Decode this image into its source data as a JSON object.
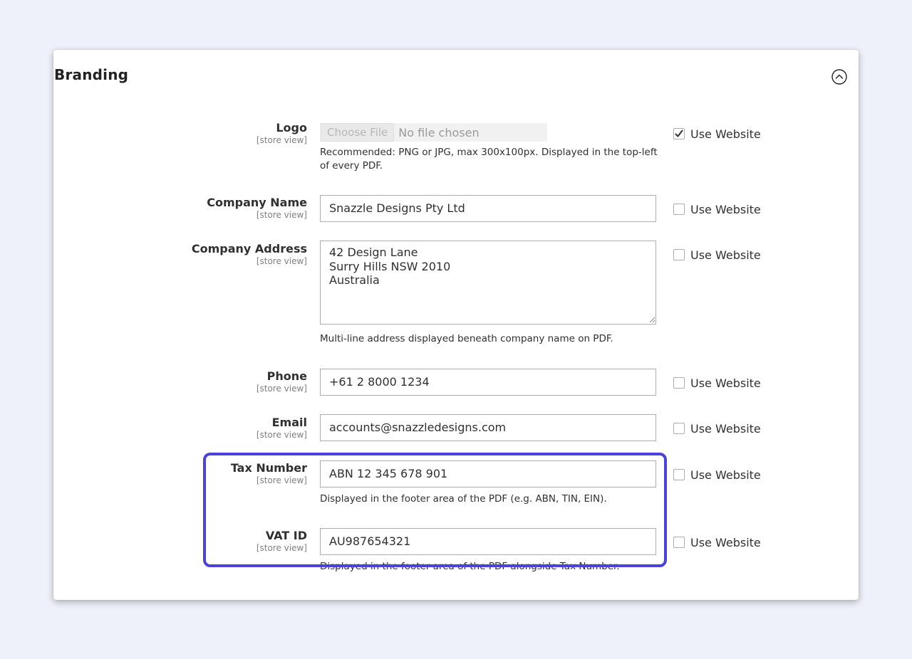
{
  "section": {
    "title": "Branding",
    "collapse_icon": "chevron-up-circle-icon"
  },
  "scope_label": "[store view]",
  "use_website_label": "Use Website",
  "fields": {
    "logo": {
      "label": "Logo",
      "button_label": "Choose File",
      "status": "No file chosen",
      "note": "Recommended: PNG or JPG, max 300x100px. Displayed in the top-left of every PDF.",
      "use_website": true
    },
    "company_name": {
      "label": "Company Name",
      "value": "Snazzle Designs Pty Ltd",
      "use_website": false
    },
    "company_address": {
      "label": "Company Address",
      "value": "42 Design Lane\nSurry Hills NSW 2010\nAustralia",
      "note": "Multi-line address displayed beneath company name on PDF.",
      "use_website": false
    },
    "phone": {
      "label": "Phone",
      "value": "+61 2 8000 1234",
      "use_website": false
    },
    "email": {
      "label": "Email",
      "value": "accounts@snazzledesigns.com",
      "use_website": false
    },
    "tax_number": {
      "label": "Tax Number",
      "value": "ABN 12 345 678 901",
      "note": "Displayed in the footer area of the PDF (e.g. ABN, TIN, EIN).",
      "use_website": false
    },
    "vat_id": {
      "label": "VAT ID",
      "value": "AU987654321",
      "note": "Displayed in the footer area of the PDF alongside Tax Number.",
      "use_website": false
    }
  },
  "colors": {
    "highlight": "#4b43d9",
    "background": "#eef0fa",
    "input_border": "#adadad"
  }
}
